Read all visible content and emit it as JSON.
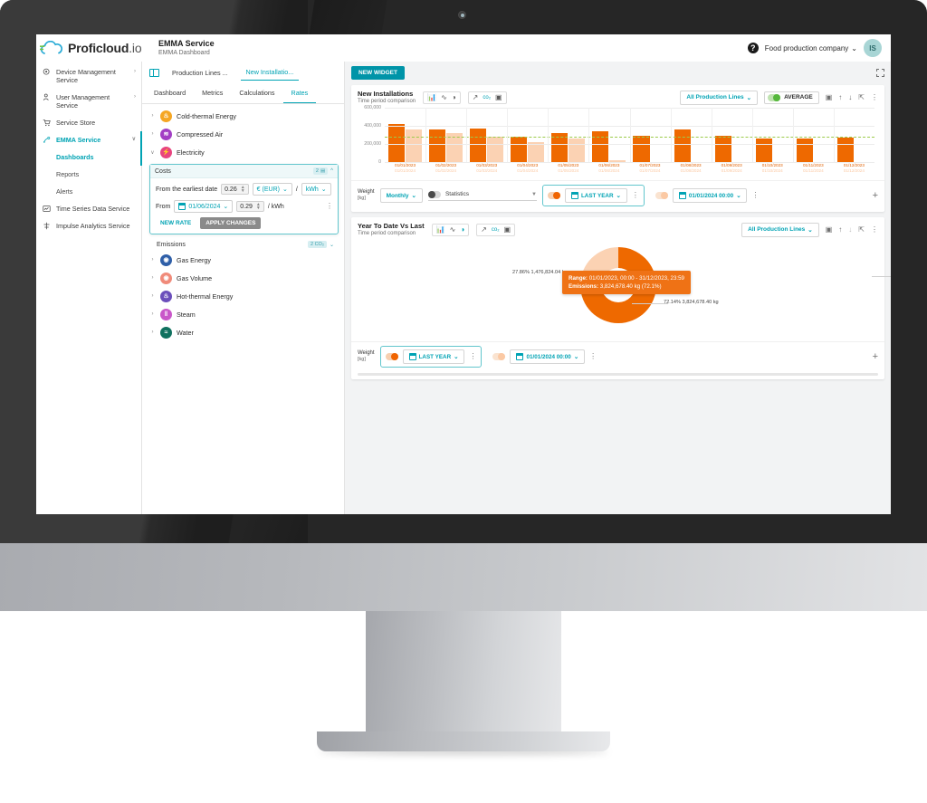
{
  "brand": {
    "name": "Proficloud",
    "suffix": ".io"
  },
  "header": {
    "title": "EMMA Service",
    "subtitle": "EMMA Dashboard",
    "help_icon": "question-mark-icon",
    "company": "Food production company",
    "avatar_initials": "IS"
  },
  "sidebar": {
    "items": [
      {
        "label": "Device Management Service",
        "icon": "device-icon",
        "chevron": "›",
        "active": false
      },
      {
        "label": "User Management Service",
        "icon": "users-icon",
        "chevron": "›",
        "active": false
      },
      {
        "label": "Service Store",
        "icon": "cart-icon",
        "chevron": "",
        "active": false
      },
      {
        "label": "EMMA Service",
        "icon": "emma-icon",
        "chevron": "∨",
        "active": true
      }
    ],
    "subitems": [
      {
        "label": "Dashboards",
        "active": true
      },
      {
        "label": "Reports",
        "active": false
      },
      {
        "label": "Alerts",
        "active": false
      }
    ],
    "items_after": [
      {
        "label": "Time Series Data Service",
        "icon": "timeseries-icon",
        "chevron": "",
        "active": false
      },
      {
        "label": "Impulse Analytics Service",
        "icon": "impulse-icon",
        "chevron": "",
        "active": false
      }
    ]
  },
  "breadcrumb_tabs": [
    {
      "label": "Production Lines ...",
      "active": false
    },
    {
      "label": "New Installatio...",
      "active": true
    }
  ],
  "tabs": [
    {
      "label": "Dashboard",
      "active": false
    },
    {
      "label": "Metrics",
      "active": false
    },
    {
      "label": "Calculations",
      "active": false
    },
    {
      "label": "Rates",
      "active": true
    }
  ],
  "tree_top": [
    {
      "label": "Cold-thermal Energy",
      "icon": "thermometer-icon",
      "color": "#f5a623",
      "glyph": "↑",
      "caret": "›"
    },
    {
      "label": "Compressed Air",
      "icon": "air-icon",
      "color": "#a23fc4",
      "glyph": "≋",
      "caret": "›"
    },
    {
      "label": "Electricity",
      "icon": "bolt-icon",
      "color": "#e8447f",
      "glyph": "⚡",
      "caret": "∨"
    }
  ],
  "tree_bottom": [
    {
      "label": "Gas Energy",
      "icon": "gas-icon",
      "color": "#2f5fa8",
      "glyph": "◎",
      "caret": "›"
    },
    {
      "label": "Gas Volume",
      "icon": "gas-volume-icon",
      "color": "#f08b7a",
      "glyph": "◎",
      "caret": "›"
    },
    {
      "label": "Hot-thermal Energy",
      "icon": "thermometer-icon",
      "color": "#6b4fbb",
      "glyph": "↓",
      "caret": "›"
    },
    {
      "label": "Steam",
      "icon": "steam-icon",
      "color": "#c957c9",
      "glyph": "‖",
      "caret": "›"
    },
    {
      "label": "Water",
      "icon": "water-icon",
      "color": "#10715f",
      "glyph": "≈",
      "caret": "›"
    }
  ],
  "costs_card": {
    "title": "Costs",
    "badge": "2",
    "badge_icon": "currency-icon",
    "collapse_icon": "chevron-up-icon",
    "row1": {
      "label": "From the earliest date",
      "value": "0.26",
      "currency": "€ (EUR)",
      "separator": "/",
      "unit": "kWh"
    },
    "row2": {
      "label": "From",
      "date": "01/06/2024",
      "value": "0.29",
      "unit_suffix": "/ kWh",
      "menu_icon": "kebab-menu-icon"
    },
    "new_rate_label": "NEW RATE",
    "apply_label": "APPLY CHANGES"
  },
  "emissions_card": {
    "title": "Emissions",
    "badge": "2 CO₂",
    "collapse_icon": "chevron-down-icon"
  },
  "main": {
    "new_widget_label": "NEW WIDGET",
    "fullscreen_icon": "expand-icon"
  },
  "widget1": {
    "title": "New Installations",
    "subtitle": "Time period comparison",
    "icons": [
      "bar-chart-icon",
      "line-chart-icon",
      "pie-chart-icon",
      "trend-icon",
      "co2-icon",
      "table-icon"
    ],
    "active_icon": "bar-chart-icon",
    "production_lines": "All Production Lines",
    "average_label": "AVERAGE",
    "average_on": true,
    "actions": [
      "present-icon",
      "arrow-up-icon",
      "arrow-down-icon",
      "resize-icon",
      "kebab-menu-icon"
    ],
    "footer": {
      "weight_label": "Weight",
      "weight_unit": "[kg]",
      "granularity": "Monthly",
      "statistics_label": "Statistics",
      "statistics_on": false,
      "range1": "LAST YEAR",
      "range1_on": true,
      "range2": "01/01/2024 00:00",
      "range2_on": false,
      "add_icon": "plus-icon"
    }
  },
  "widget2": {
    "title": "Year To Date Vs Last",
    "subtitle": "Time period comparison",
    "icons": [
      "bar-chart-icon",
      "line-chart-icon",
      "pie-chart-icon",
      "trend-icon",
      "co2-icon",
      "table-icon"
    ],
    "active_icon": "pie-chart-icon",
    "production_lines": "All Production Lines",
    "actions": [
      "present-icon",
      "arrow-up-icon",
      "arrow-down-icon",
      "resize-icon",
      "kebab-menu-icon"
    ],
    "footer": {
      "weight_label": "Weight",
      "weight_unit": "[kg]",
      "range1": "LAST YEAR",
      "range1_on": true,
      "range2": "01/01/2024 00:00",
      "range2_on": false,
      "add_icon": "plus-icon"
    },
    "tooltip": {
      "range_label": "Range:",
      "range_value": "01/01/2023, 00:00 - 31/12/2023, 23:59",
      "emissions_label": "Emissions:",
      "emissions_value": "3,824,678.40 kg (72.1%)"
    }
  },
  "chart_data": [
    {
      "type": "bar",
      "title": "New Installations",
      "subtitle": "Time period comparison",
      "xlabel": "",
      "ylabel": "",
      "ylim": [
        0,
        600000
      ],
      "yticks": [
        0,
        200000,
        400000,
        600000
      ],
      "ytick_labels": [
        "0",
        "200,000",
        "400,000",
        "600,000"
      ],
      "grid": true,
      "legend_position": "none",
      "average_line": 280000,
      "average_color": "#9ccb4a",
      "categories": [
        "01/01/2023",
        "01/02/2023",
        "01/03/2023",
        "01/04/2023",
        "01/05/2023",
        "01/06/2023",
        "01/07/2023",
        "01/08/2023",
        "01/09/2023",
        "01/10/2023",
        "01/11/2023",
        "01/12/2023"
      ],
      "categories_secondary": [
        "01/01/2024",
        "01/02/2024",
        "01/03/2024",
        "01/04/2024",
        "01/05/2024",
        "01/06/2024",
        "01/07/2024",
        "01/08/2024",
        "01/09/2024",
        "01/10/2024",
        "01/11/2024",
        "01/12/2024"
      ],
      "series": [
        {
          "name": "LAST YEAR",
          "color": "#ee6900",
          "values": [
            420000,
            365000,
            372000,
            278000,
            322000,
            338000,
            292000,
            360000,
            287000,
            262000,
            265000,
            273000
          ]
        },
        {
          "name": "01/01/2024 00:00",
          "color": "#fbd2b3",
          "values": [
            357000,
            317000,
            285000,
            224000,
            263000,
            22000,
            0,
            0,
            0,
            0,
            0,
            0
          ]
        }
      ]
    },
    {
      "type": "pie",
      "title": "Year To Date Vs Last",
      "subtitle": "Time period comparison",
      "legend_position": "none",
      "labels": [
        "01/01/2024 00:00",
        "LAST YEAR"
      ],
      "values": [
        1476824.04,
        3824678.4
      ],
      "percentages": [
        27.86,
        72.14
      ],
      "colors": [
        "#fbd2b3",
        "#ee6900"
      ],
      "data_labels": [
        "27.86% 1,476,824.04 kg",
        "72.14% 3,824,678.40 kg"
      ],
      "unit": "kg"
    }
  ]
}
